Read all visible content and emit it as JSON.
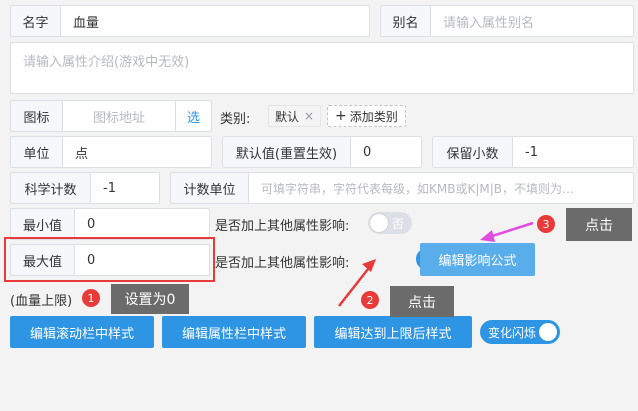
{
  "name": {
    "label": "名字",
    "value": "血量"
  },
  "alias": {
    "label": "别名",
    "placeholder": "请输入属性别名"
  },
  "description": {
    "placeholder": "请输入属性介绍(游戏中无效)"
  },
  "icon": {
    "label": "图标",
    "placeholder": "图标地址",
    "select": "选"
  },
  "category": {
    "label": "类别:",
    "tag": "默认",
    "tag_close": "×",
    "add": "添加类别",
    "add_icon": "+"
  },
  "unit": {
    "label": "单位",
    "value": "点"
  },
  "default_value": {
    "label": "默认值(重置生效)",
    "value": "0"
  },
  "decimals": {
    "label": "保留小数",
    "value": "-1"
  },
  "sci": {
    "label": "科学计数",
    "value": "-1"
  },
  "count_unit": {
    "label": "计数单位",
    "placeholder": "可填字符串，字符代表每级，如KMB或K|M|B，不填则为…"
  },
  "min": {
    "label": "最小值",
    "value": "0",
    "affect_label": "是否加上其他属性影响:",
    "toggle_text": "否",
    "toggle_on": false
  },
  "max": {
    "label": "最大值",
    "value": "0",
    "affect_label": "是否加上其他属性影响:",
    "toggle_text": "是",
    "toggle_on": true,
    "formula_button": "编辑影响公式",
    "note": "(血量上限)"
  },
  "buttons": {
    "scroll_style": "编辑滚动栏中样式",
    "attr_style": "编辑属性栏中样式",
    "max_style": "编辑达到上限后样式",
    "flash": "变化闪烁",
    "flash_on": true
  },
  "annotations": [
    {
      "num": "1",
      "text": "设置为0"
    },
    {
      "num": "2",
      "text": "点击"
    },
    {
      "num": "3",
      "text": "点击"
    }
  ],
  "colors": {
    "accent": "#2d95e3",
    "formula_button": "#5aadeb",
    "highlight": "#e8393b",
    "arrow": "#e8393b",
    "arrow2": "#e04be0"
  }
}
